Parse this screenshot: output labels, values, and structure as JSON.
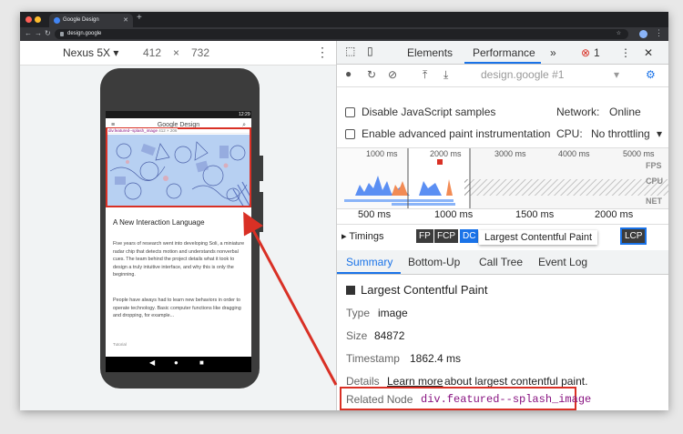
{
  "browser": {
    "tab_title": "Google Design",
    "url": "design.google"
  },
  "device_toolbar": {
    "device": "Nexus 5X",
    "width": "412",
    "times": "×",
    "height": "732"
  },
  "phone": {
    "time": "12:29",
    "site_title": "Google Design",
    "element_tag": "div.featured--splash_image",
    "element_size": "412 × 206",
    "article_title": "A New Interaction Language",
    "paragraph1": "Five years of research went into developing Soli, a miniature radar chip that detects motion and understands nonverbal cues. The team behind the project details what it took to design a truly intuitive interface, and why this is only the beginning.",
    "paragraph2": "People have always had to learn new behaviors in order to operate technology. Basic computer functions like dragging and dropping, for example...",
    "tag": "Tutorial"
  },
  "devtools": {
    "tabs": [
      "Elements",
      "Performance",
      "»"
    ],
    "error_count": "1",
    "profile_select": "design.google #1",
    "options": {
      "disable_js": "Disable JavaScript samples",
      "network_label": "Network:",
      "network_value": "Online",
      "paint": "Enable advanced paint instrumentation",
      "cpu_label": "CPU:",
      "cpu_value": "No throttling"
    },
    "overview_ticks": [
      "1000 ms",
      "2000 ms",
      "3000 ms",
      "4000 ms",
      "5000 ms"
    ],
    "overview_labels": [
      "FPS",
      "CPU",
      "NET"
    ],
    "main_ticks": [
      "500 ms",
      "1000 ms",
      "1500 ms",
      "2000 ms"
    ],
    "timings_label": "Timings",
    "markers": [
      "FP",
      "FCP",
      "DC",
      "LCP"
    ],
    "tooltip": "Largest Contentful Paint",
    "subtabs": [
      "Summary",
      "Bottom-Up",
      "Call Tree",
      "Event Log"
    ],
    "summary": {
      "title": "Largest Contentful Paint",
      "type_label": "Type",
      "type_value": "image",
      "size_label": "Size",
      "size_value": "84872",
      "timestamp_label": "Timestamp",
      "timestamp_value": "1862.4 ms",
      "details_label": "Details",
      "learn_more": "Learn more",
      "details_text": "about largest contentful paint.",
      "related_label": "Related Node",
      "related_value": "div.featured--splash_image"
    }
  },
  "colors": {
    "accent": "#1a73e8",
    "highlight": "#d93025",
    "marker": "#3c3c3c"
  }
}
